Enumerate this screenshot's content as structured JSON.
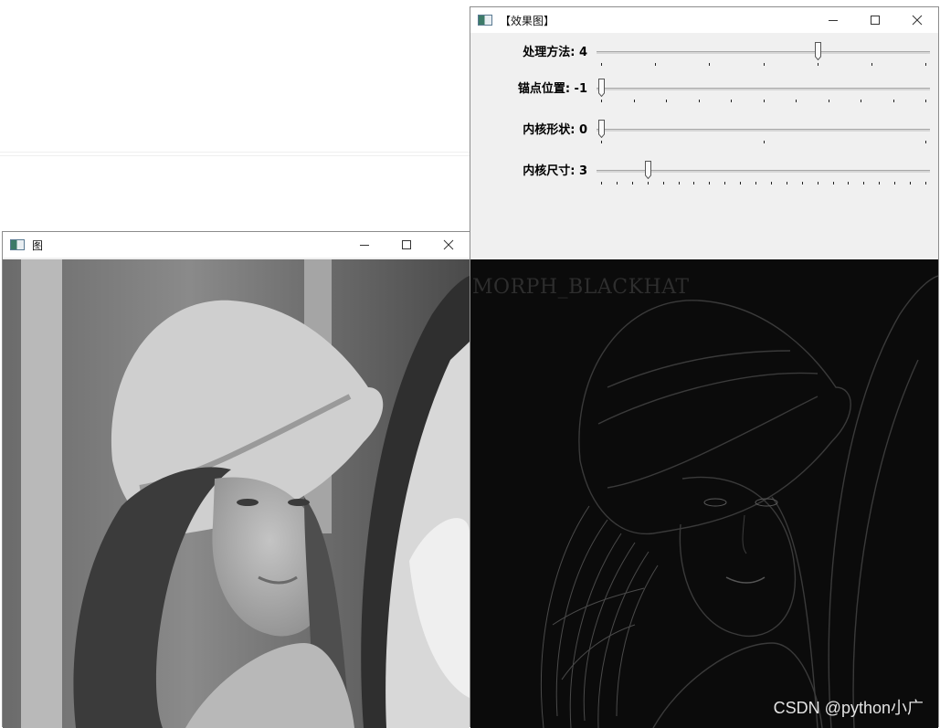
{
  "windows": {
    "source": {
      "title": "图",
      "controls": [
        "minimize-icon",
        "maximize-icon",
        "close-icon"
      ]
    },
    "effect": {
      "title": "【效果图】",
      "controls": [
        "minimize-icon",
        "maximize-icon",
        "close-icon"
      ],
      "trackbars": [
        {
          "label": "处理方法: 4",
          "value": 4,
          "min": 0,
          "max": 6
        },
        {
          "label": "锚点位置: -1",
          "value": -1,
          "min": -1,
          "max": 9
        },
        {
          "label": "内核形状: 0",
          "value": 0,
          "min": 0,
          "max": 2
        },
        {
          "label": "内核尺寸: 3",
          "value": 3,
          "min": 0,
          "max": 21
        }
      ],
      "image_caption": "MORPH_BLACKHAT"
    }
  },
  "watermark": "CSDN @python小广",
  "colors": {
    "titlebar": "#ffffff",
    "panel": "#f0f0f0",
    "result_bg": "#0b0b0b"
  }
}
